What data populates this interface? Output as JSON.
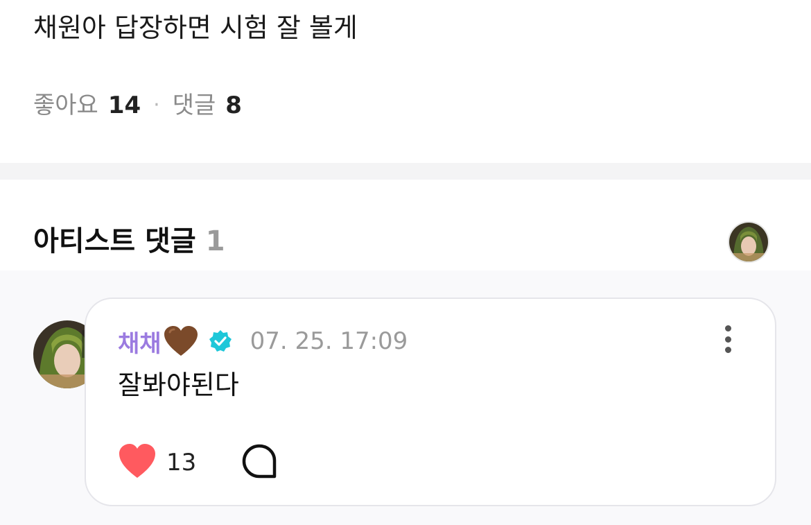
{
  "post": {
    "text": "채원아 답장하면 시험 잘 볼게",
    "likes_label": "좋아요",
    "likes_count": "14",
    "separator": "·",
    "comments_label": "댓글",
    "comments_count": "8"
  },
  "artist_comments": {
    "title": "아티스트 댓글",
    "count": "1",
    "avatar_icon": "artist-avatar"
  },
  "comment": {
    "author": "채채",
    "author_emoji": "brown-heart",
    "verified_icon": "verified-badge",
    "date": "07. 25. 17:09",
    "text": "잘봐야된다",
    "like_count": "13",
    "more_icon": "more-vertical-icon",
    "reply_icon": "reply-bubble-icon"
  },
  "colors": {
    "author": "#9b7be0",
    "verified": "#1ec7d9",
    "like_heart": "#ff5a5f",
    "divider": "#f4f4f5",
    "comment_bg": "#f9f9fb"
  }
}
